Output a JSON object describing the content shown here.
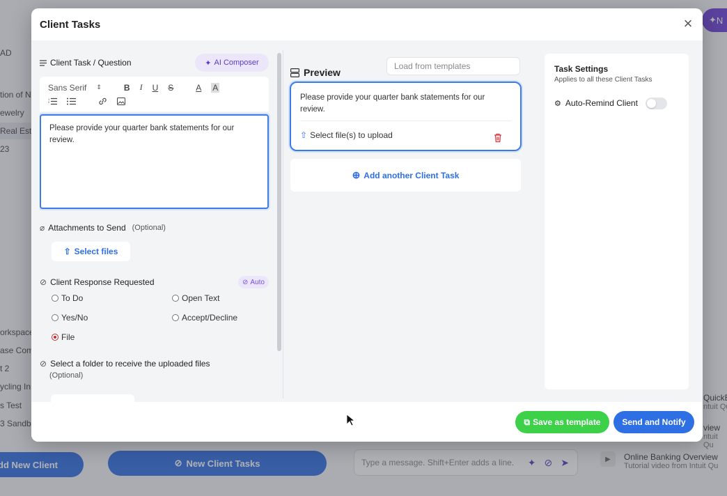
{
  "background": {
    "sidebar_items": [
      "AD",
      "tion of N",
      "ewelry",
      "Real Esta",
      "23",
      "orkspace",
      "ase Com",
      "t 2",
      "ycling In",
      "s Test",
      "3 Sandbo"
    ],
    "add_client_label": "dd New Client",
    "new_tasks_label": "New Client Tasks",
    "chat_placeholder": "Type a message. Shift+Enter adds a line.",
    "videos": [
      {
        "title": "QuickB",
        "sub": "ntuit Qu"
      },
      {
        "title": "view",
        "sub": "ntuit Qu"
      },
      {
        "title": "Online Banking Overview",
        "sub": "Tutorial video from Intuit Qu"
      }
    ],
    "top_right_btn": "N"
  },
  "modal": {
    "title": "Client Tasks",
    "close_label": "×",
    "left": {
      "task_label": "Client Task / Question",
      "ai_composer": "AI Composer",
      "font_name": "Sans Serif",
      "toolbar": {
        "bold": "B",
        "italic": "I",
        "underline": "U",
        "strike": "S",
        "color": "A",
        "bg": "A"
      },
      "editor_text": "Please provide your quarter bank statements for our review.",
      "attachments_label": "Attachments to Send",
      "optional": "(Optional)",
      "select_files": "Select files",
      "response_label": "Client Response Requested",
      "auto_badge": "Auto",
      "options": [
        "To Do",
        "Open Text",
        "Yes/No",
        "Accept/Decline",
        "File"
      ],
      "selected_option": "File",
      "folder_label": "Select a folder to receive the uploaded files",
      "folder_optional": "(Optional)"
    },
    "preview": {
      "title": "Preview",
      "templates_placeholder": "Load from templates",
      "card_text": "Please provide your quarter bank statements for our review.",
      "upload_label": "Select file(s) to upload",
      "add_task": "Add another Client Task"
    },
    "settings": {
      "title": "Task Settings",
      "subtitle": "Applies to all these Client Tasks",
      "auto_remind": "Auto-Remind Client",
      "auto_remind_on": false
    },
    "footer": {
      "save_template": "Save as template",
      "send_notify": "Send and Notify"
    }
  },
  "colors": {
    "primary": "#2f6fe4",
    "success": "#3dd14a",
    "accent_purple": "#5a3ac6",
    "danger": "#c62828"
  }
}
